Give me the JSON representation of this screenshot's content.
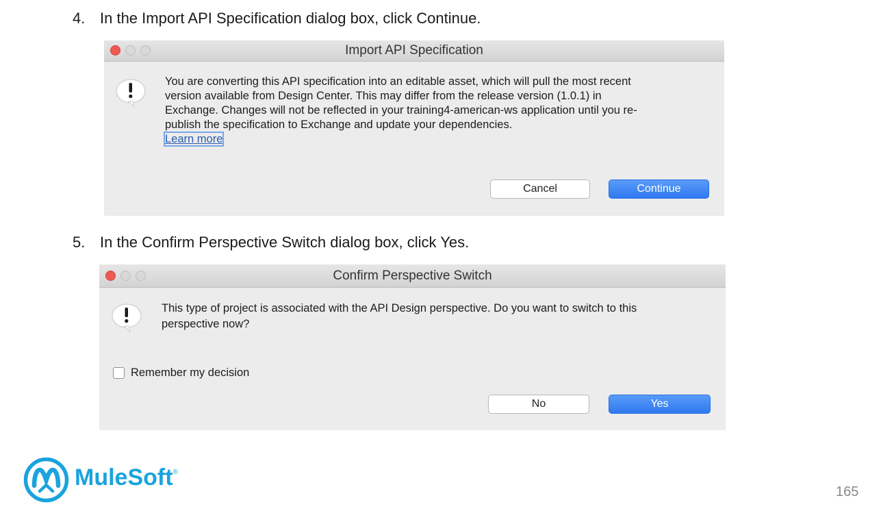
{
  "steps": [
    {
      "number": "4.",
      "text": "In the Import API Specification dialog box, click Continue."
    },
    {
      "number": "5.",
      "text": "In the Confirm Perspective Switch dialog box, click Yes."
    }
  ],
  "import_dialog": {
    "title": "Import API Specification",
    "message_lines": [
      "You are converting this API specification into an editable asset, which will pull the most recent",
      "version available from Design Center. This may differ from the release version (1.0.1) in",
      "Exchange. Changes will not be reflected in your training4-american-ws application until you re-",
      "publish the specification to Exchange and update your dependencies."
    ],
    "link": "Learn more",
    "cancel_label": "Cancel",
    "continue_label": "Continue"
  },
  "confirm_dialog": {
    "title": "Confirm Perspective Switch",
    "message_lines": [
      "This type of project is associated with the API Design perspective. Do you want to switch to this",
      "perspective now?"
    ],
    "remember_label": "Remember my decision",
    "remember_checked": false,
    "no_label": "No",
    "yes_label": "Yes"
  },
  "logo": {
    "text": "MuleSoft",
    "registered_mark": "®"
  },
  "page_number": "165",
  "colors": {
    "accent_blue": "#2f78f0",
    "brand": "#1aa3dd",
    "close_red": "#ee5a52"
  }
}
